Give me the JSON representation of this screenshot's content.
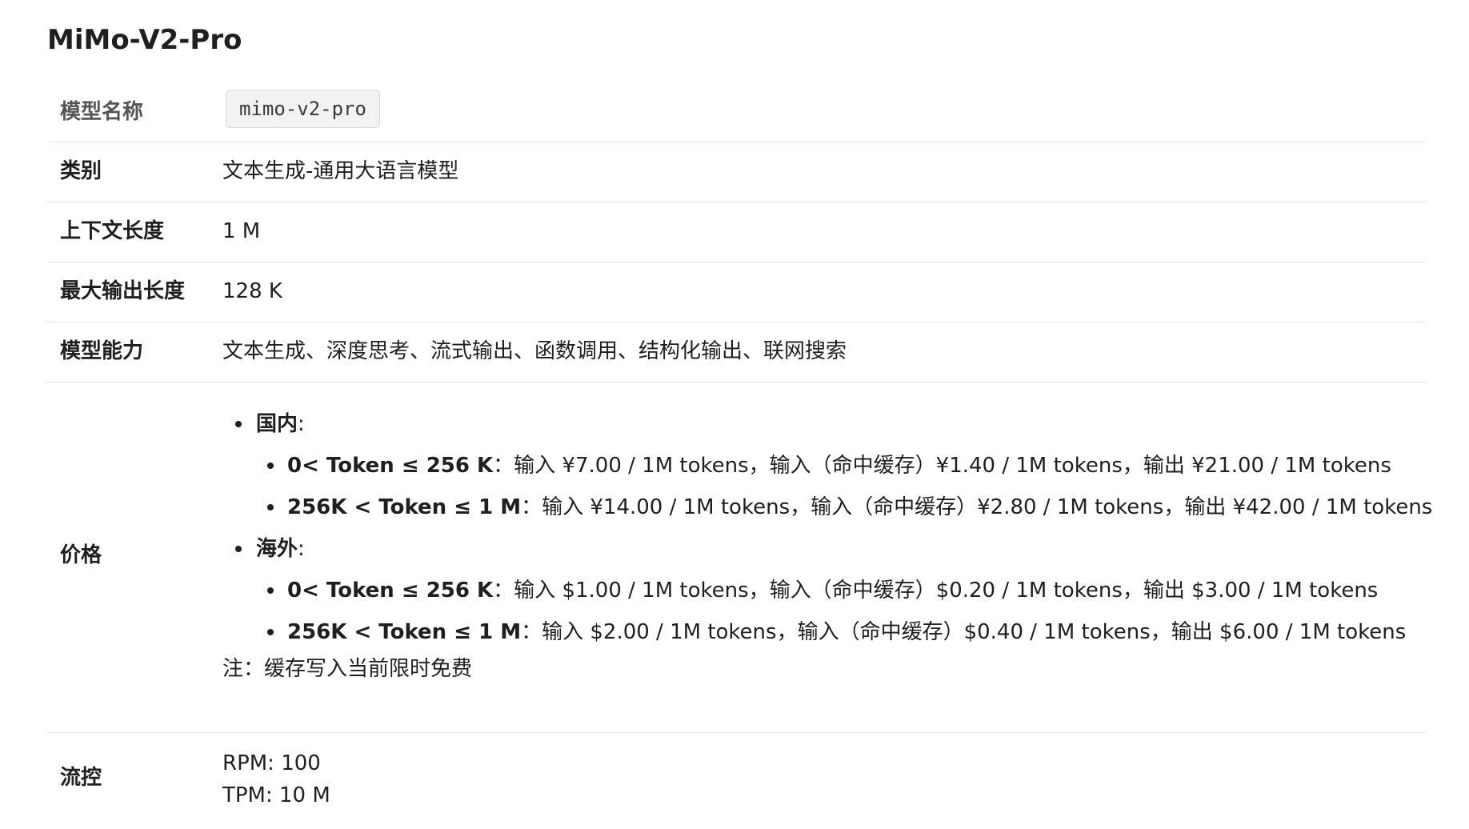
{
  "title": "MiMo-V2-Pro",
  "rows": {
    "model_name": {
      "label": "模型名称",
      "value": "mimo-v2-pro"
    },
    "category": {
      "label": "类别",
      "value": "文本生成-通用大语言模型"
    },
    "context_length": {
      "label": "上下文长度",
      "value": "1 M"
    },
    "max_output": {
      "label": "最大输出长度",
      "value": "128 K"
    },
    "capabilities": {
      "label": "模型能力",
      "value": "文本生成、深度思考、流式输出、函数调用、结构化输出、联网搜索"
    },
    "pricing": {
      "label": "价格",
      "domestic": {
        "region": "国内",
        "colon": ":",
        "tiers": [
          {
            "tier": "0< Token ≤ 256 K",
            "detail": "：输入 ¥7.00 / 1M tokens，输入（命中缓存）¥1.40 / 1M tokens，输出 ¥21.00 / 1M tokens"
          },
          {
            "tier": "256K < Token ≤ 1 M",
            "detail": "：输入 ¥14.00 / 1M tokens，输入（命中缓存）¥2.80 / 1M tokens，输出 ¥42.00 / 1M tokens"
          }
        ]
      },
      "overseas": {
        "region": "海外",
        "colon": ":",
        "tiers": [
          {
            "tier": "0< Token ≤ 256 K",
            "detail": "：输入 $1.00 / 1M tokens，输入（命中缓存）$0.20 / 1M tokens，输出 $3.00 / 1M tokens"
          },
          {
            "tier": "256K < Token ≤ 1 M",
            "detail": "：输入 $2.00 / 1M tokens，输入（命中缓存）$0.40 / 1M tokens，输出 $6.00 / 1M tokens"
          }
        ]
      },
      "note": "注：缓存写入当前限时免费"
    },
    "rate_limit": {
      "label": "流控",
      "rpm": "RPM: 100",
      "tpm": "TPM: 10 M"
    }
  }
}
